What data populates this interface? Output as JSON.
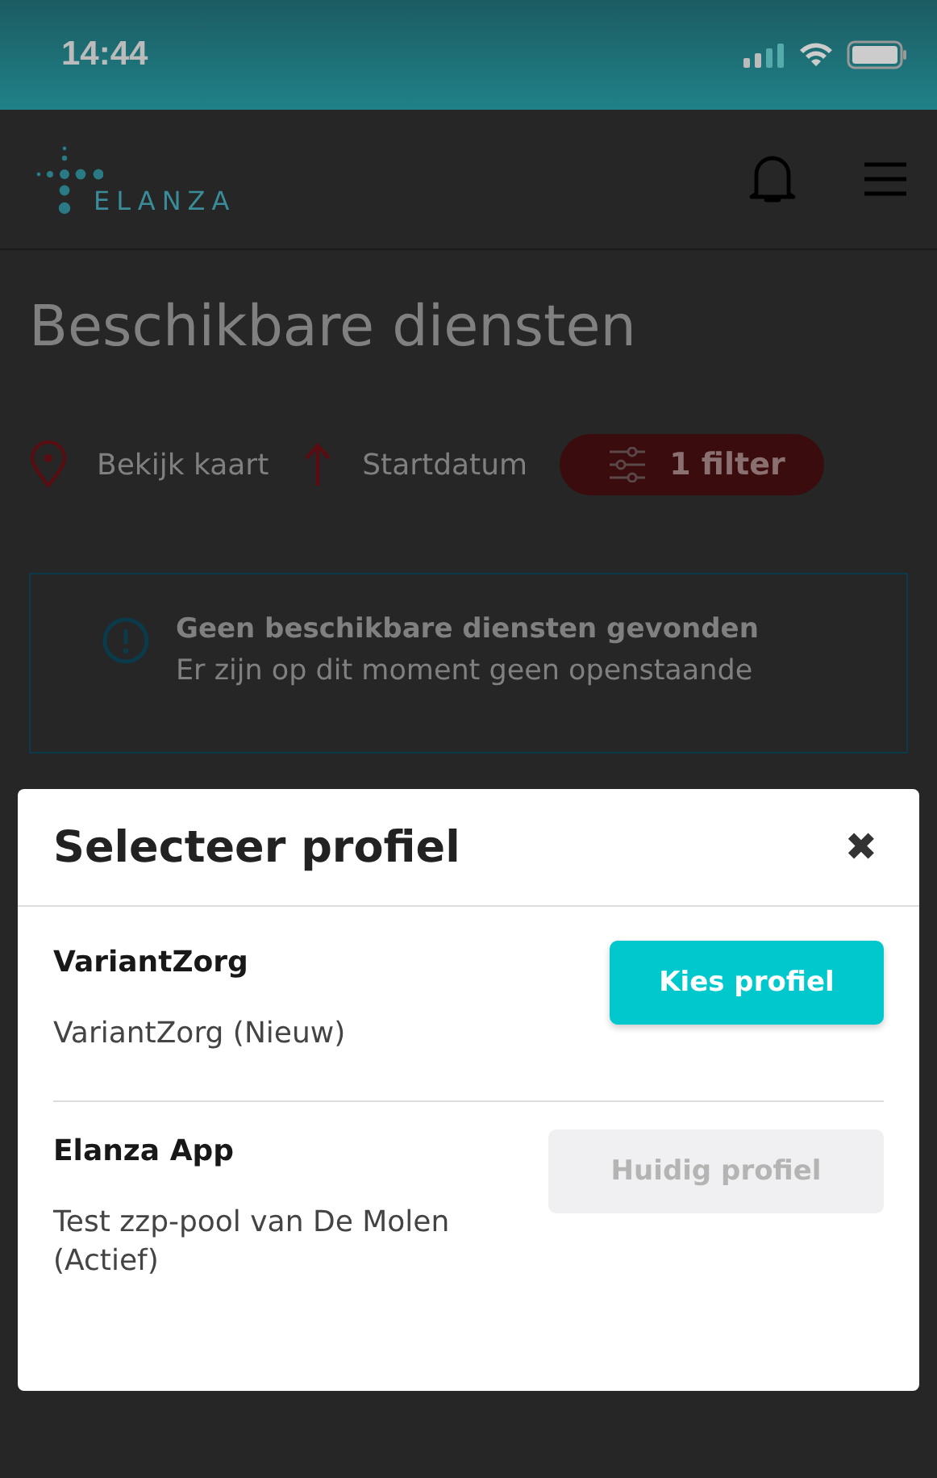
{
  "status_bar": {
    "time": "14:44"
  },
  "header": {
    "logo": "ELANZA"
  },
  "page": {
    "title": "Beschikbare diensten",
    "map_link": "Bekijk kaart",
    "sort": "Startdatum",
    "filter": "1 filter"
  },
  "notice": {
    "title": "Geen beschikbare diensten gevonden",
    "text": "Er zijn op dit moment geen openstaande"
  },
  "modal": {
    "title": "Selecteer profiel",
    "close": "✖",
    "profiles": [
      {
        "name": "VariantZorg",
        "description": "VariantZorg (Nieuw)",
        "button": "Kies profiel",
        "current": false
      },
      {
        "name": "Elanza App",
        "description": "Test zzp-pool van De Molen (Actief)",
        "button": "Huidig profiel",
        "current": true
      }
    ]
  }
}
